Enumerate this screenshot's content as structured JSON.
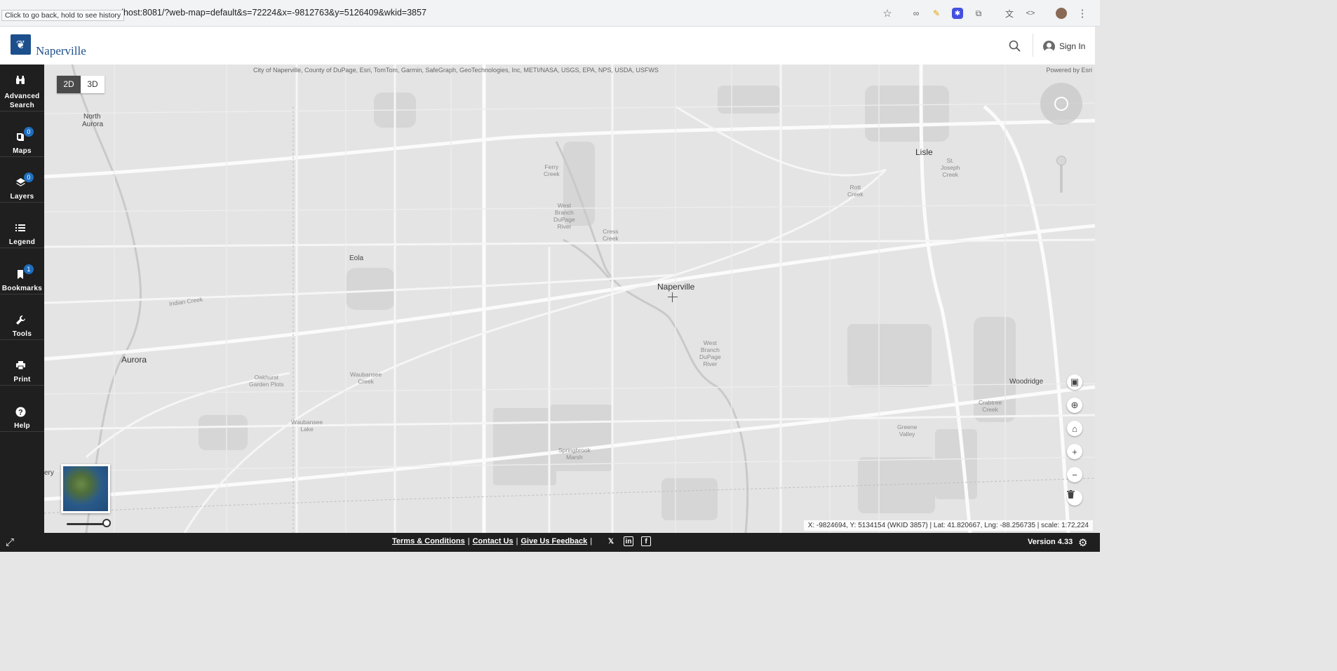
{
  "browser": {
    "url": "calhost:8081/?web-map=default&s=72224&x=-9812763&y=5126409&wkid=3857",
    "back_tooltip": "Click to go back, hold to see history"
  },
  "header": {
    "logo_text": "Naperville",
    "sign_in_label": "Sign In"
  },
  "sidebar": {
    "items": [
      {
        "label_line1": "Advanced",
        "label_line2": "Search",
        "icon": "binoculars-icon"
      },
      {
        "label_line1": "Maps",
        "label_line2": "",
        "icon": "book-icon",
        "badge": "0"
      },
      {
        "label_line1": "Layers",
        "label_line2": "",
        "icon": "layers-icon",
        "badge": "0"
      },
      {
        "label_line1": "Legend",
        "label_line2": "",
        "icon": "list-icon"
      },
      {
        "label_line1": "Bookmarks",
        "label_line2": "",
        "icon": "bookmark-icon",
        "badge": "1"
      },
      {
        "label_line1": "Tools",
        "label_line2": "",
        "icon": "wrench-icon"
      },
      {
        "label_line1": "Print",
        "label_line2": "",
        "icon": "printer-icon"
      },
      {
        "label_line1": "Help",
        "label_line2": "",
        "icon": "help-icon"
      }
    ]
  },
  "map": {
    "attribution": "City of Naperville, County of DuPage, Esri, TomTom, Garmin, SafeGraph, GeoTechnologies, Inc, METI/NASA, USGS, EPA, NPS, USDA, USFWS",
    "powered_by": "Powered by Esri",
    "toggle_2d": "2D",
    "toggle_3d": "3D",
    "places": {
      "north_aurora_1": "North",
      "north_aurora_2": "Aurora",
      "lisle": "Lisle",
      "eola": "Eola",
      "naperville": "Naperville",
      "aurora": "Aurora",
      "woodridge": "Woodridge",
      "ery": "ery"
    },
    "water": {
      "ferry_creek": "Ferry\nCreek",
      "west_branch_1": "West\nBranch\nDuPage\nRiver",
      "cress_creek": "Cress\nCreek",
      "st_joseph_creek": "St.\nJoseph\nCreek",
      "rott_creek": "Rott\nCreek",
      "indian_creek": "Indian Creek",
      "west_branch_2": "West\nBranch\nDuPage\nRiver",
      "oakhurst": "Oakhurst\nGarden Plots",
      "waubansee_creek": "Waubansee\nCreek",
      "waubansee_lake": "Waubansee\nLake",
      "springbrook": "Springbrook\nMarsh",
      "crabtree": "Crabtree\nCreek",
      "greene_valley": "Greene\nValley"
    },
    "coordinates": "X: -9824694, Y: 5134154 (WKID 3857) | Lat: 41.820667, Lng: -88.256735 | scale: 1:72,224"
  },
  "footer": {
    "terms": "Terms & Conditions",
    "sep1": "|",
    "contact": "Contact Us",
    "sep2": "|",
    "feedback": "Give Us Feedback",
    "sep3": "|",
    "version": "Version 4.33"
  }
}
